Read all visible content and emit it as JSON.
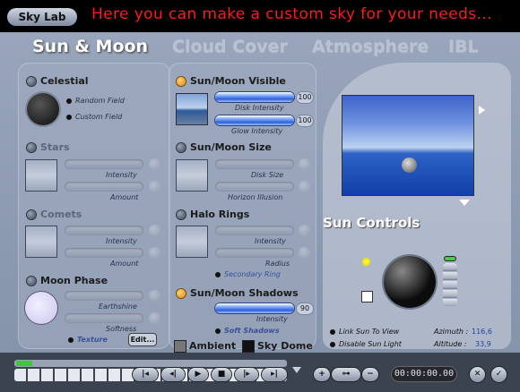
{
  "app": {
    "title": "Sky Lab",
    "annotation": "Here you can make a custom sky for your needs..."
  },
  "tabs": [
    "Sun & Moon",
    "Cloud Cover",
    "Atmosphere",
    "IBL"
  ],
  "celestial": {
    "label": "Celestial",
    "opt1": "Random Field",
    "opt2": "Custom Field"
  },
  "stars": {
    "label": "Stars",
    "s1": "Intensity",
    "s2": "Amount"
  },
  "comets": {
    "label": "Comets",
    "s1": "Intensity",
    "s2": "Amount"
  },
  "moon_phase": {
    "label": "Moon Phase",
    "s1": "Earthshine",
    "s2": "Softness",
    "texture": "Texture",
    "edit": "Edit..."
  },
  "sunmoon_visible": {
    "label": "Sun/Moon Visible",
    "s1": "Disk Intensity",
    "v1": "100",
    "s2": "Glow Intensity",
    "v2": "100"
  },
  "sunmoon_size": {
    "label": "Sun/Moon Size",
    "s1": "Disk Size",
    "s2": "Horizon Illusion"
  },
  "halo_rings": {
    "label": "Halo Rings",
    "s1": "Intensity",
    "s2": "Radius",
    "secondary": "Secondary Ring"
  },
  "sunmoon_shadows": {
    "label": "Sun/Moon Shadows",
    "s1": "Intensity",
    "v1": "90",
    "soft": "Soft Shadows"
  },
  "ambient": "Ambient",
  "sky_dome": "Sky Dome",
  "sun_controls": {
    "title": "Sun Controls",
    "link": "Link Sun To View",
    "disable": "Disable Sun Light",
    "azimuth_label": "Azimuth :",
    "azimuth": "116,6",
    "altitude_label": "Altitude :",
    "altitude": "33,9"
  },
  "timeline": {
    "time": "00:00:00.00"
  },
  "icons": [
    "play-icon",
    "stop-icon",
    "key-icon",
    "check-icon",
    "close-icon"
  ],
  "colors": {
    "accent_orange": "#e08a00",
    "slider_blue": "#2f5fd8",
    "annotation_red": "#ff1a1a"
  }
}
